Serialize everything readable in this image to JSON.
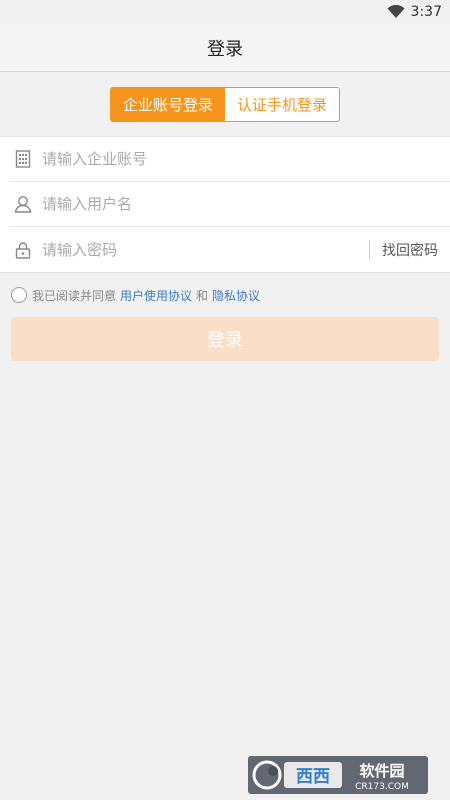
{
  "status_bar": {
    "time": "3:37",
    "wifi_icon": "wifi-icon"
  },
  "header": {
    "title": "登录"
  },
  "tabs": [
    {
      "label": "企业账号登录",
      "active": true
    },
    {
      "label": "认证手机登录",
      "active": false
    }
  ],
  "form": {
    "company_placeholder": "请输入企业账号",
    "username_placeholder": "请输入用户名",
    "password_placeholder": "请输入密码",
    "find_password": "找回密码"
  },
  "agreement": {
    "prefix": "我已阅读并同意",
    "user_agreement": "用户使用协议",
    "and": "和",
    "privacy": "隐私协议"
  },
  "login_button": "登录",
  "watermark": {
    "text": "西西软件园",
    "domain": "CR173.COM"
  },
  "colors": {
    "accent": "#f7941d",
    "link": "#3d7cc8",
    "button_disabled": "#fbdec8"
  }
}
